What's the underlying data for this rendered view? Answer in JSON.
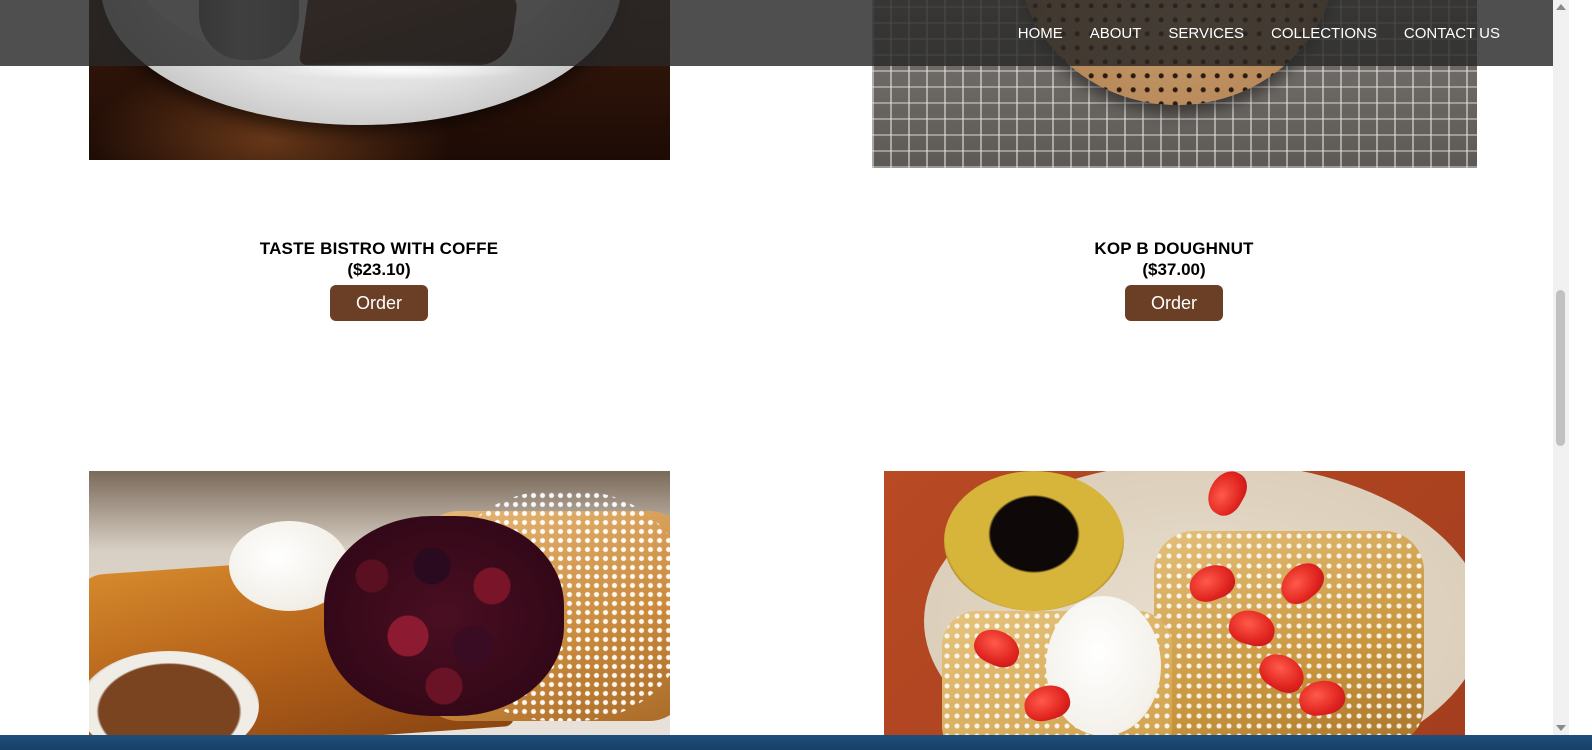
{
  "nav": {
    "items": [
      {
        "label": "HOME"
      },
      {
        "label": "ABOUT"
      },
      {
        "label": "SERVICES"
      },
      {
        "label": "COLLECTIONS"
      },
      {
        "label": "CONTACT US"
      }
    ]
  },
  "products": [
    {
      "name": "TASTE BISTRO WITH COFFE",
      "price": "($23.10)",
      "button": "Order",
      "image": "bistro-coffee-photo"
    },
    {
      "name": "KOP B DOUGHNUT",
      "price": "($37.00)",
      "button": "Order",
      "image": "doughnut-photo"
    },
    {
      "image": "berry-french-toast-photo"
    },
    {
      "image": "strawberry-french-toast-photo"
    }
  ],
  "colors": {
    "accent": "#6b3f26",
    "navbar": "#2a2a2a",
    "text": "#000000"
  }
}
